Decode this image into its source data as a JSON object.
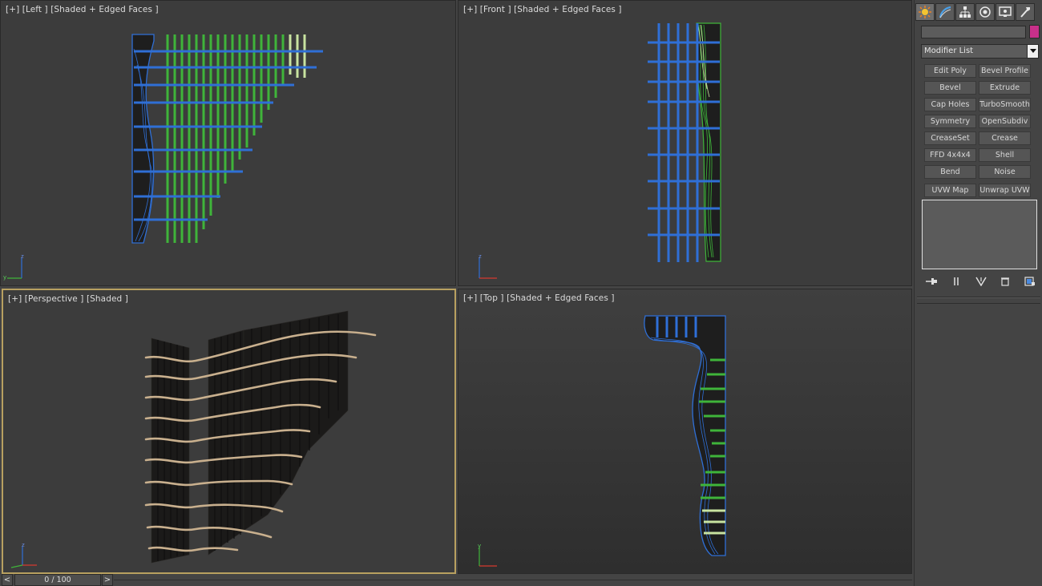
{
  "viewports": {
    "left": {
      "plus": "[+]",
      "view": "[Left ]",
      "mode": "[Shaded + Edged Faces ]"
    },
    "front": {
      "plus": "[+]",
      "view": "[Front ]",
      "mode": "[Shaded + Edged Faces ]"
    },
    "perspective": {
      "plus": "[+]",
      "view": "[Perspective ]",
      "mode": "[Shaded ]"
    },
    "top": {
      "plus": "[+]",
      "view": "[Top ]",
      "mode": "[Shaded + Edged Faces ]"
    }
  },
  "command_panel": {
    "tabs": [
      "create-icon",
      "modify-icon",
      "hierarchy-icon",
      "motion-icon",
      "display-icon",
      "utilities-icon"
    ],
    "object_name": "",
    "object_color": "#c8308a",
    "modifier_list_label": "Modifier List",
    "modifier_buttons": [
      "Edit Poly",
      "Bevel Profile",
      "Bevel",
      "Extrude",
      "Cap Holes",
      "TurboSmooth",
      "Symmetry",
      "OpenSubdiv",
      "CreaseSet",
      "Crease",
      "FFD 4x4x4",
      "Shell",
      "Bend",
      "Noise",
      "UVW Map",
      "Unwrap UVW"
    ]
  },
  "timeline": {
    "prev": "<",
    "next": ">",
    "frame_display": "0 / 100"
  },
  "colors": {
    "selection_blue": "#2f6fd6",
    "slice_green": "#3fb43a",
    "slice_pale": "#c8e3a0",
    "wood": "#c9b08e",
    "panel_dark": "#1e1e1e",
    "active_border": "#b8a060"
  }
}
